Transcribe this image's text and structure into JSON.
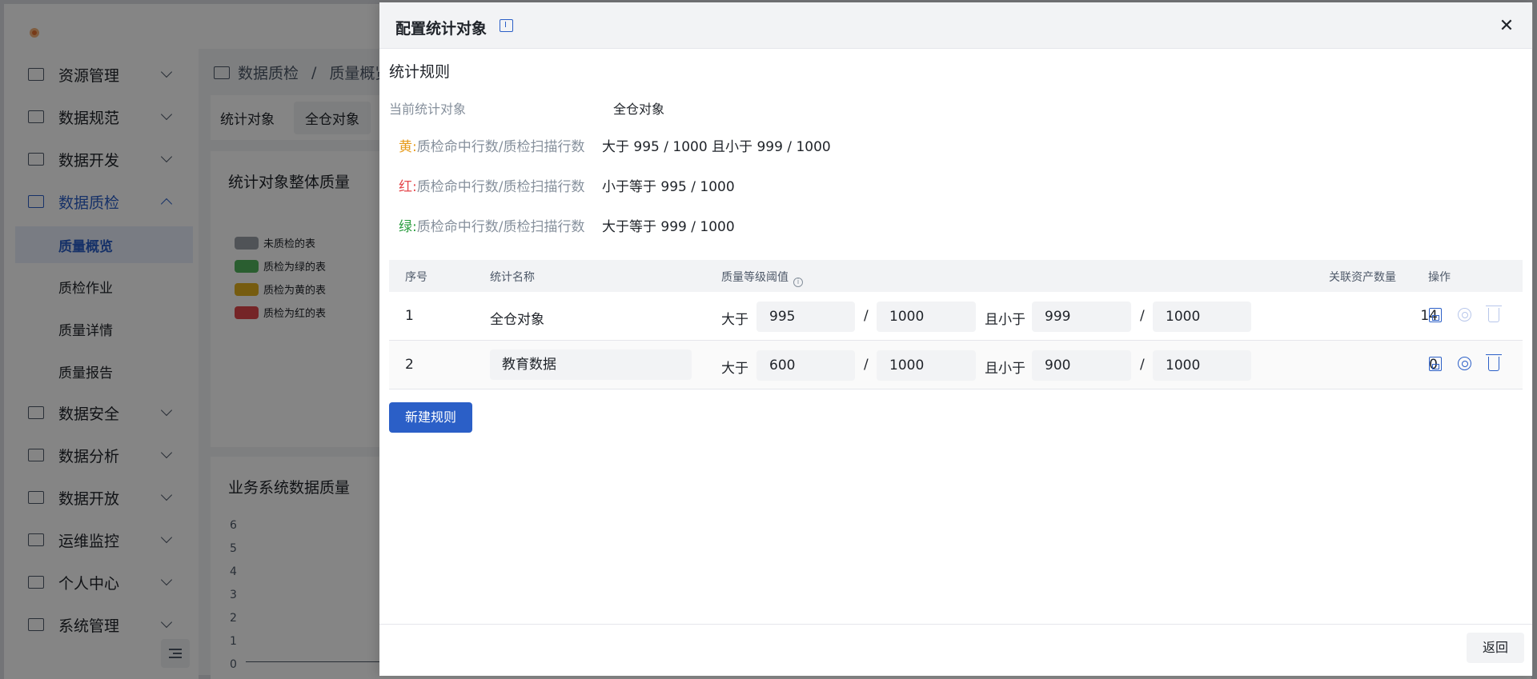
{
  "sidebar": {
    "items": [
      {
        "label": "资源管理"
      },
      {
        "label": "数据规范"
      },
      {
        "label": "数据开发"
      },
      {
        "label": "数据质检"
      },
      {
        "label": "数据安全"
      },
      {
        "label": "数据分析"
      },
      {
        "label": "数据开放"
      },
      {
        "label": "运维监控"
      },
      {
        "label": "个人中心"
      },
      {
        "label": "系统管理"
      }
    ],
    "sub_items": [
      {
        "label": "质量概览"
      },
      {
        "label": "质检作业"
      },
      {
        "label": "质量详情"
      },
      {
        "label": "质量报告"
      }
    ]
  },
  "breadcrumb": {
    "parent": "数据质检",
    "separator": "/",
    "current": "质量概览"
  },
  "filter": {
    "label": "统计对象",
    "value": "全仓对象"
  },
  "overall_card": {
    "title": "统计对象整体质量",
    "legend": [
      {
        "label": "未质检的表",
        "color": "#9aa0a8"
      },
      {
        "label": "质检为绿的表",
        "color": "#52b45c"
      },
      {
        "label": "质检为黄的表",
        "color": "#e3b11f"
      },
      {
        "label": "质检为红的表",
        "color": "#e1474b"
      }
    ]
  },
  "business_card": {
    "title": "业务系统数据质量",
    "y_ticks": [
      "6",
      "5",
      "4",
      "3",
      "2",
      "1",
      "0"
    ]
  },
  "drawer": {
    "title": "配置统计对象",
    "section_title": "统计规则",
    "current_label": "当前统计对象",
    "current_value": "全仓对象",
    "rules": [
      {
        "key": "黄:",
        "name": "质检命中行数/质检扫描行数",
        "desc": "大于  995 / 1000  且小于  999 / 1000",
        "color": "#e79b1a"
      },
      {
        "key": "红:",
        "name": "质检命中行数/质检扫描行数",
        "desc": "小于等于  995 / 1000",
        "color": "#e5484d"
      },
      {
        "key": "绿:",
        "name": "质检命中行数/质检扫描行数",
        "desc": "大于等于  999 / 1000",
        "color": "#2a9d3f"
      }
    ],
    "table": {
      "headers": {
        "index": "序号",
        "name": "统计名称",
        "threshold": "质量等级阈值",
        "count": "关联资产数量",
        "actions": "操作"
      },
      "rows": [
        {
          "index": "1",
          "name": "全仓对象",
          "gt_label": "大于",
          "gt_num": "995",
          "gt_den": "1000",
          "lt_label": "且小于",
          "lt_num": "999",
          "lt_den": "1000",
          "count": "14"
        },
        {
          "index": "2",
          "name": "教育数据",
          "gt_label": "大于",
          "gt_num": "600",
          "gt_den": "1000",
          "lt_label": "且小于",
          "lt_num": "900",
          "lt_den": "1000",
          "count": "0"
        }
      ],
      "slash": "/"
    },
    "new_button": "新建规则",
    "back_button": "返回"
  }
}
